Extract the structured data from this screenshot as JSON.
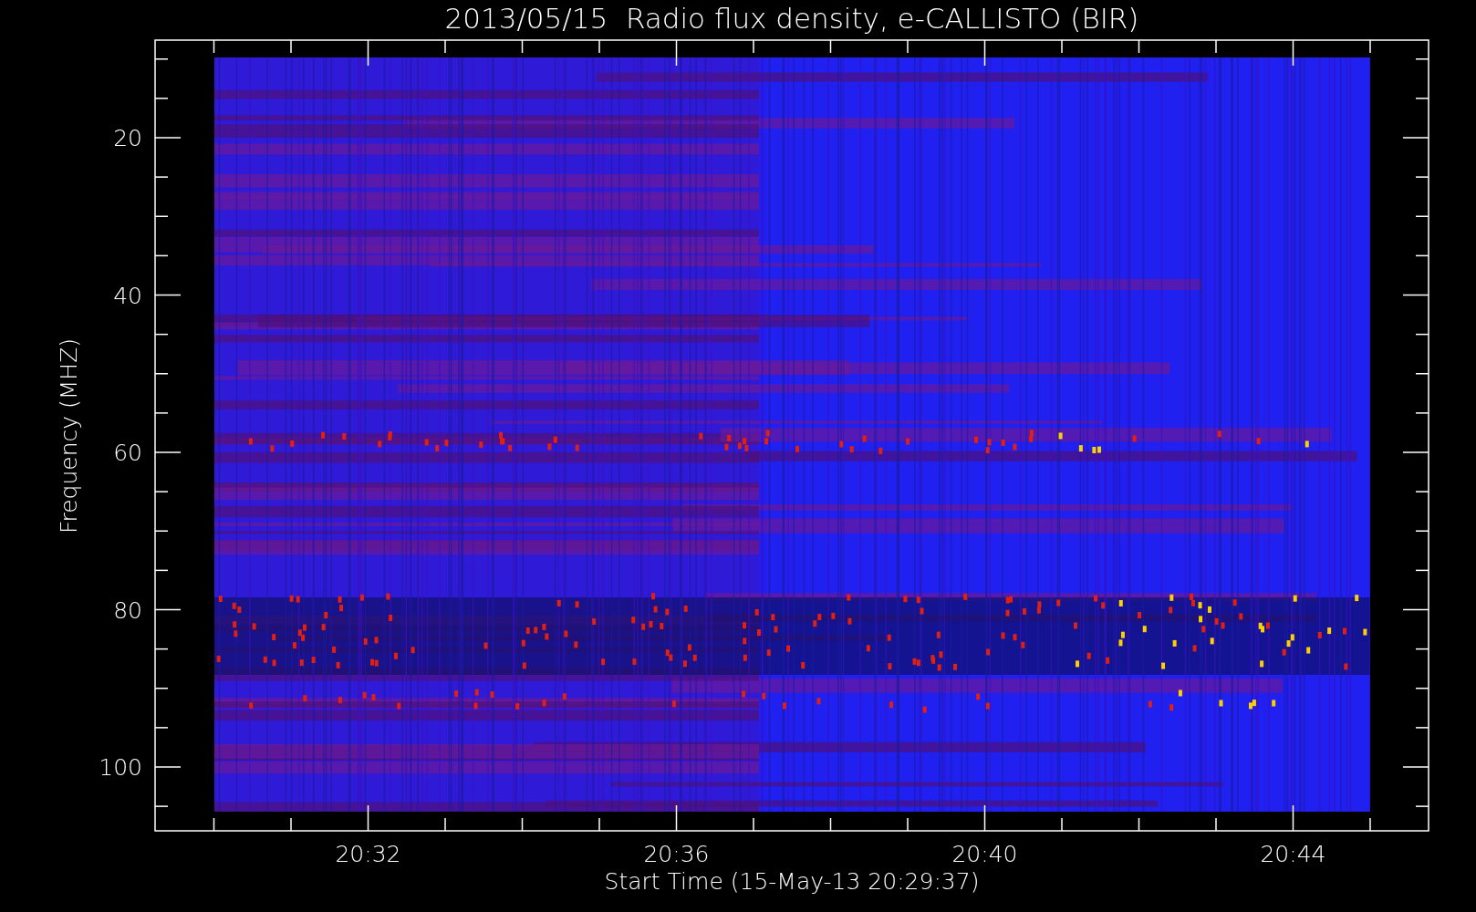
{
  "title": "2013/05/15  Radio flux density, e-CALLISTO (BIR)",
  "y_axis": {
    "label": "Frequency (MHZ)",
    "ticks": [
      "20",
      "40",
      "60",
      "80",
      "100"
    ]
  },
  "x_axis": {
    "label": "Start Time (15-May-13 20:29:37)",
    "ticks": [
      "20:32",
      "20:36",
      "20:40",
      "20:44"
    ]
  }
}
